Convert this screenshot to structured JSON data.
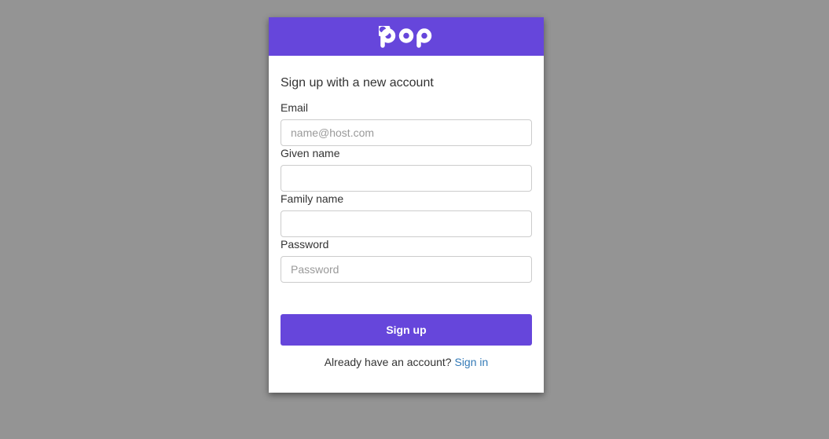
{
  "brand": {
    "logo_text": "pop",
    "color": "#6646db"
  },
  "form": {
    "heading": "Sign up with a new account",
    "fields": [
      {
        "label": "Email",
        "placeholder": "name@host.com",
        "value": ""
      },
      {
        "label": "Given name",
        "placeholder": "",
        "value": ""
      },
      {
        "label": "Family name",
        "placeholder": "",
        "value": ""
      },
      {
        "label": "Password",
        "placeholder": "Password",
        "value": ""
      }
    ],
    "submit_label": "Sign up"
  },
  "footer": {
    "prompt": "Already have an account?",
    "link_label": "Sign in",
    "link_color": "#337ab7"
  },
  "colors": {
    "page_background": "#949494",
    "card_background": "#ffffff"
  }
}
